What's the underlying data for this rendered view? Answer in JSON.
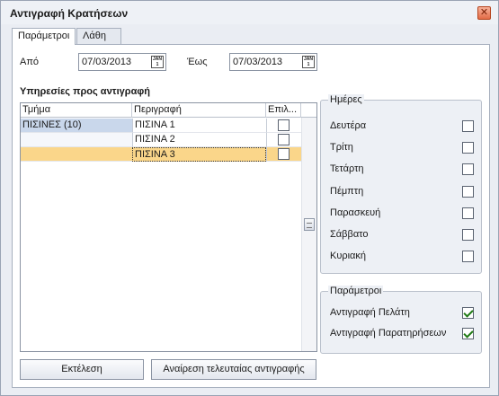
{
  "window": {
    "title": "Αντιγραφή Κρατήσεων"
  },
  "tabs": [
    {
      "label": "Παράμετροι",
      "active": true
    },
    {
      "label": "Λάθη",
      "active": false
    }
  ],
  "dates": {
    "from_label": "Από",
    "from_value": "07/03/2013",
    "to_label": "Έως",
    "to_value": "07/03/2013",
    "calendar_icon_text": "JAN"
  },
  "services": {
    "title": "Υπηρεσίες προς αντιγραφή",
    "columns": [
      "Τμήμα",
      "Περιγραφή",
      "Επιλ..."
    ],
    "rows": [
      {
        "department": "ΠΙΣΙΝΕΣ (10)",
        "description": "ΠΙΣΙΝΑ 1",
        "selected": false
      },
      {
        "department": "",
        "description": "ΠΙΣΙΝΑ 2",
        "selected": false
      },
      {
        "department": "",
        "description": "ΠΙΣΙΝΑ 3",
        "selected": false
      }
    ]
  },
  "days_group": {
    "title": "Ημέρες",
    "days": [
      {
        "label": "Δευτέρα",
        "checked": false
      },
      {
        "label": "Τρίτη",
        "checked": false
      },
      {
        "label": "Τετάρτη",
        "checked": false
      },
      {
        "label": "Πέμπτη",
        "checked": false
      },
      {
        "label": "Παρασκευή",
        "checked": false
      },
      {
        "label": "Σάββατο",
        "checked": false
      },
      {
        "label": "Κυριακή",
        "checked": false
      }
    ]
  },
  "params_group": {
    "title": "Παράμετροι",
    "options": [
      {
        "label": "Αντιγραφή Πελάτη",
        "checked": true
      },
      {
        "label": "Αντιγραφή Παρατηρήσεων",
        "checked": true
      }
    ]
  },
  "buttons": {
    "execute": "Εκτέλεση",
    "undo": "Αναίρεση τελευταίας αντιγραφής"
  },
  "colors": {
    "selected_row": "#fad68a",
    "group_row": "#c9d7eb",
    "accent_check": "#1f7a14"
  }
}
